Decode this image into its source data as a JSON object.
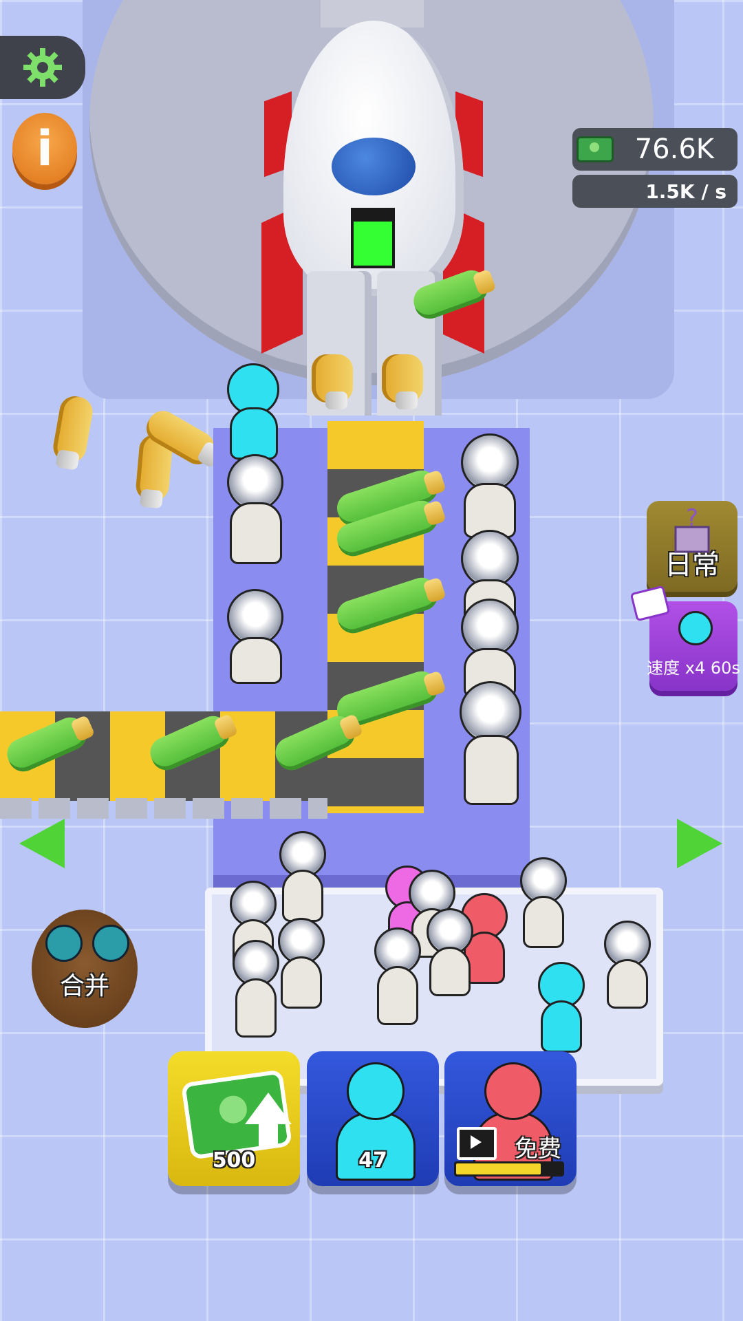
{
  "hud": {
    "money": "76.6K",
    "rate": "1.5K / s",
    "settings_icon": "gear-icon",
    "info_icon": "info-icon",
    "info_glyph": "i"
  },
  "rocket": {
    "fuel_level": 0.8
  },
  "side_buttons": {
    "daily_label": "日常",
    "speed_label": "速度 x4 60s"
  },
  "merge_label": "合并",
  "bottom": {
    "money_upgrade_value": "500",
    "worker_count": "47",
    "free_label": "免费",
    "free_progress": 0.8
  },
  "colors": {
    "accent_green": "#4fd336",
    "cyan_worker": "#2fe0f0",
    "red_worker": "#ef5b67",
    "button_blue": "#3458dd",
    "button_yellow": "#f4dc2a"
  }
}
